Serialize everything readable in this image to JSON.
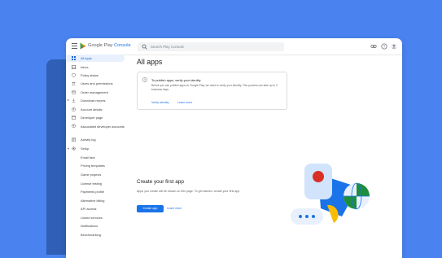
{
  "brand": {
    "text_prefix": "Google Play ",
    "text_accent": "Console"
  },
  "search": {
    "placeholder": "Search Play Console"
  },
  "sidebar": {
    "items": [
      {
        "label": "All apps",
        "icon": "apps-grid-icon",
        "active": true
      },
      {
        "label": "Inbox",
        "icon": "inbox-icon"
      },
      {
        "label": "Policy status",
        "icon": "shield-icon"
      },
      {
        "label": "Users and permissions",
        "icon": "people-icon"
      },
      {
        "label": "Order management",
        "icon": "credit-card-icon"
      },
      {
        "label": "Download reports",
        "icon": "download-icon",
        "expandable": true
      },
      {
        "label": "Account details",
        "icon": "account-icon"
      },
      {
        "label": "Developer page",
        "icon": "web-page-icon"
      },
      {
        "label": "Associated developer accounts",
        "icon": "link-accounts-icon"
      },
      {
        "label": "Activity log",
        "icon": "log-icon"
      },
      {
        "label": "Setup",
        "icon": "gear-icon",
        "expandable": true
      },
      {
        "label": "Email lists"
      },
      {
        "label": "Pricing templates"
      },
      {
        "label": "Game projects"
      },
      {
        "label": "License testing"
      },
      {
        "label": "Payments profile"
      },
      {
        "label": "Alternative billing"
      },
      {
        "label": "API access"
      },
      {
        "label": "Linked services"
      },
      {
        "label": "Notifications"
      },
      {
        "label": "Benchmarking"
      }
    ]
  },
  "main": {
    "title": "All apps",
    "notice": {
      "title": "To publish apps, verify your identity",
      "body": "Before you can publish apps on Google Play, we need to verify your identity. This process can take up to 3 business days.",
      "verify_link": "Verify identity",
      "learn_link": "Learn more"
    },
    "create": {
      "title": "Create your first app",
      "body": "Apps you create will be shown on this page. To get started, create your first app",
      "button": "Create app",
      "learn_link": "Learn more"
    }
  },
  "colors": {
    "accent": "#1a73e8",
    "background": "#4a83f0",
    "active_bg": "#e8f0fe"
  }
}
